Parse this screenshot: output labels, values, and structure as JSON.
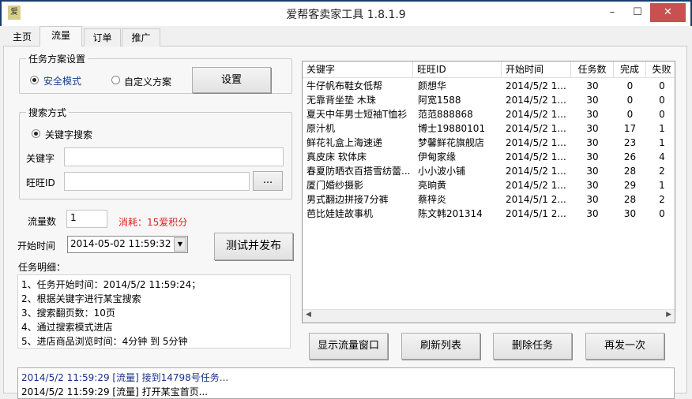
{
  "window": {
    "title": "爱帮客卖家工具 1.8.1.9",
    "logo_text": "爱",
    "minimize": "–",
    "maximize": "☐",
    "close": "✕"
  },
  "tabs": [
    {
      "label": "主页"
    },
    {
      "label": "流量"
    },
    {
      "label": "订单"
    },
    {
      "label": "推广"
    }
  ],
  "plan_group": {
    "title": "任务方案设置",
    "radio_safe": "安全模式",
    "radio_custom": "自定义方案",
    "settings_button": "设置"
  },
  "search_group": {
    "title": "搜索方式",
    "radio_keyword": "关键字搜索",
    "keyword_label": "关键字",
    "keyword_value": "",
    "wangwang_label": "旺旺ID",
    "wangwang_value": "",
    "browse_button": "..."
  },
  "traffic": {
    "label": "流量数",
    "value": "1",
    "cost": "消耗：15爱积分",
    "cost_color": "#e02020"
  },
  "start_time": {
    "label": "开始时间",
    "value": "2014-05-02 11:59:32"
  },
  "test_publish_button": "测试并发布",
  "detail": {
    "label": "任务明细：",
    "lines": [
      "1、任务开始时间：2014/5/2 11:59:24；",
      "2、根据关键字进行某宝搜索",
      "3、搜索翻页数：10页",
      "4、通过搜索模式进店",
      "5、进店商品浏览时间：4分钟 到 5分钟"
    ]
  },
  "table": {
    "columns": [
      "关键字",
      "旺旺ID",
      "开始时间",
      "任务数",
      "完成",
      "失败"
    ],
    "rows": [
      [
        "牛仔帆布鞋女低帮",
        "颜想华",
        "2014/5/2 1...",
        "30",
        "0",
        "0"
      ],
      [
        "无靠背坐垫 木珠",
        "阿宽1588",
        "2014/5/2 1...",
        "30",
        "0",
        "0"
      ],
      [
        "夏天中年男士短袖T恤衫",
        "范范888868",
        "2014/5/2 1...",
        "30",
        "0",
        "0"
      ],
      [
        "原汁机",
        "博士19880101",
        "2014/5/2 1...",
        "30",
        "17",
        "1"
      ],
      [
        "鲜花礼盒上海速递",
        "梦馨鲜花旗舰店",
        "2014/5/2 1...",
        "30",
        "23",
        "1"
      ],
      [
        "真皮床 软体床",
        "伊甸家缘",
        "2014/5/2 1...",
        "30",
        "26",
        "4"
      ],
      [
        "春夏防晒衣百搭雪纺蕾...",
        "小小波小铺",
        "2014/5/2 1...",
        "30",
        "28",
        "2"
      ],
      [
        "厦门婚纱摄影",
        "亮晌黄",
        "2014/5/2 1...",
        "30",
        "29",
        "1"
      ],
      [
        "男式翻边拼接7分裤",
        "蔡梓炎",
        "2014/5/1 2...",
        "30",
        "28",
        "2"
      ],
      [
        "芭比娃娃故事机",
        "陈文韩201314",
        "2014/5/1 2...",
        "30",
        "30",
        "0"
      ]
    ]
  },
  "actions": {
    "show_window": "显示流量窗口",
    "refresh": "刷新列表",
    "delete": "删除任务",
    "resend": "再发一次"
  },
  "log": [
    "2014/5/2 11:59:29 [流量] 接到14798号任务...",
    "2014/5/2 11:59:29 [流量] 打开某宝首页..."
  ]
}
